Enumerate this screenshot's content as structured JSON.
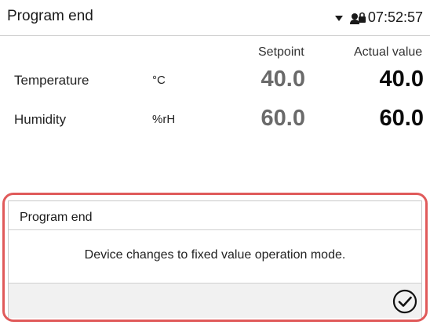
{
  "status_bar": {
    "title": "Program end",
    "dropdown_icon": "chevron-down-icon",
    "user_icon": "user-lock-icon",
    "time": "07:52:57"
  },
  "table": {
    "columns": {
      "setpoint": "Setpoint",
      "actual": "Actual value"
    },
    "rows": [
      {
        "label": "Temperature",
        "unit": "°C",
        "setpoint": "40.0",
        "actual": "40.0"
      },
      {
        "label": "Humidity",
        "unit": "%rH",
        "setpoint": "60.0",
        "actual": "60.0"
      }
    ]
  },
  "dialog": {
    "title": "Program end",
    "message": "Device changes to fixed value operation mode.",
    "confirm_icon": "check-circle-icon",
    "highlight_color": "#e05a5a"
  }
}
